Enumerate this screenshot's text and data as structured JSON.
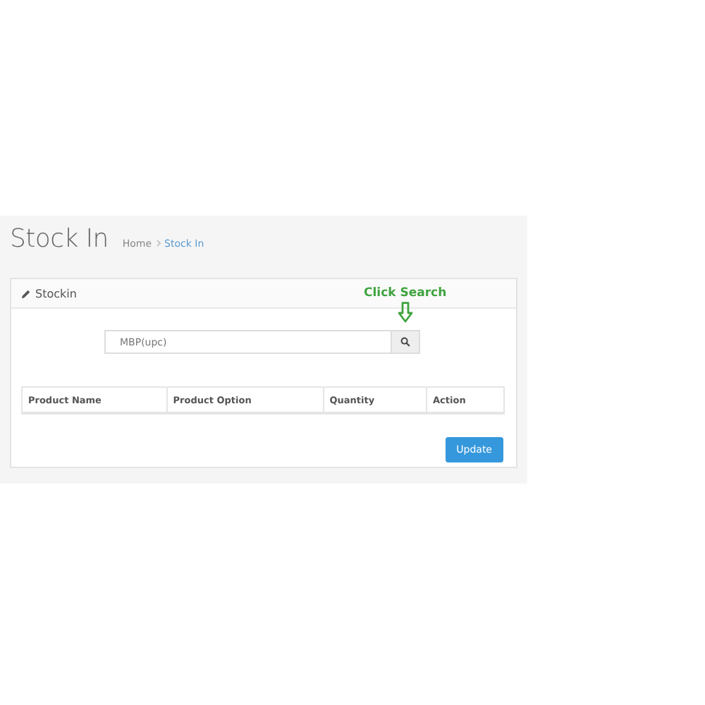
{
  "page_title": "Stock In",
  "breadcrumb": [
    {
      "label": "Home",
      "selected": false
    },
    {
      "label": "Stock In",
      "selected": true
    }
  ],
  "panel": {
    "title": "Stockin",
    "annotation": "Click Search",
    "search": {
      "value": "MBP(upc)"
    },
    "table": {
      "columns": [
        "Product Name",
        "Product Option",
        "Quantity",
        "Action"
      ]
    },
    "buttons": [
      "Update"
    ]
  }
}
